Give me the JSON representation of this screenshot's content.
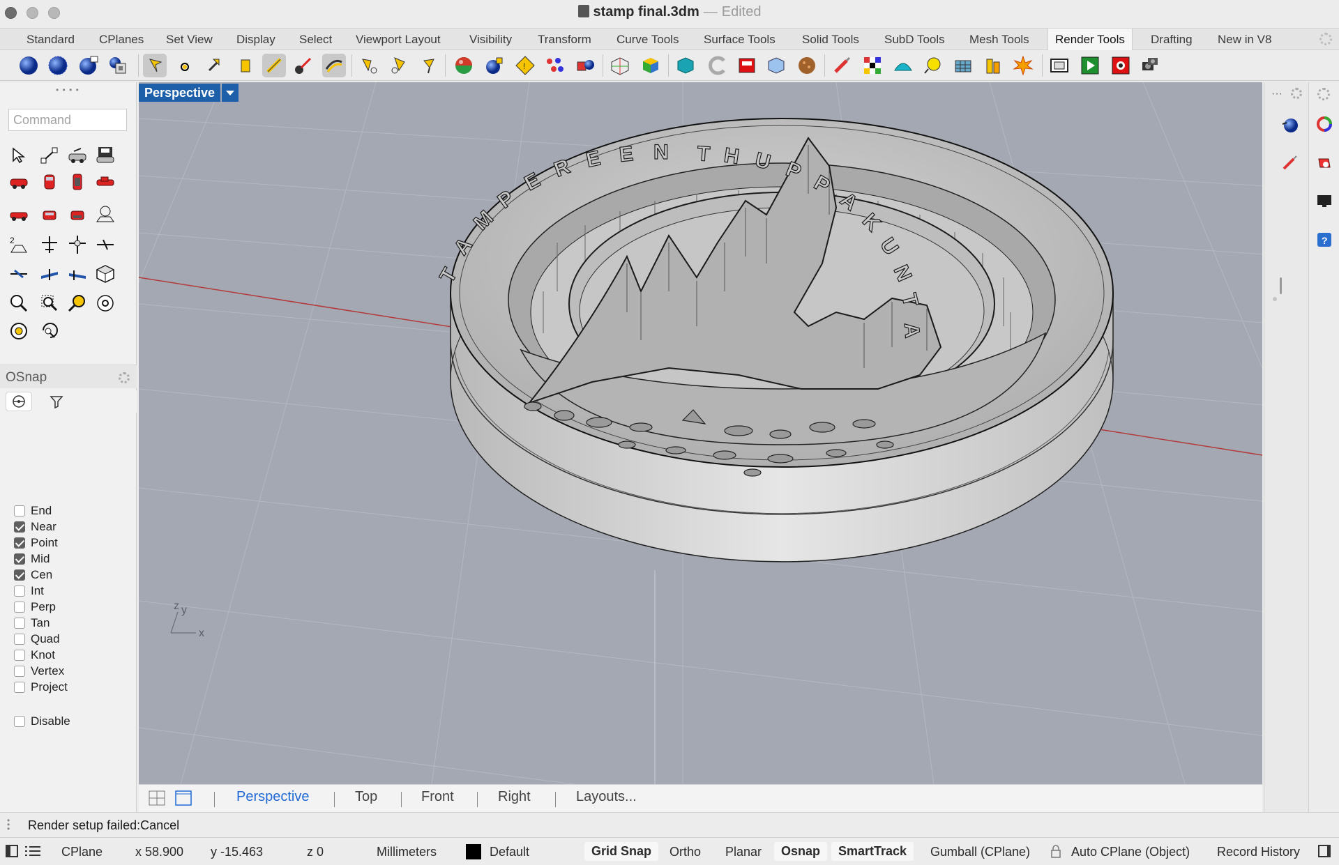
{
  "window": {
    "title": "stamp final.3dm",
    "separator": "—",
    "status": "Edited"
  },
  "tabs": [
    {
      "label": "Standard",
      "active": false
    },
    {
      "label": "CPlanes",
      "active": false
    },
    {
      "label": "Set View",
      "active": false
    },
    {
      "label": "Display",
      "active": false
    },
    {
      "label": "Select",
      "active": false
    },
    {
      "label": "Viewport Layout",
      "active": false
    },
    {
      "label": "Visibility",
      "active": false
    },
    {
      "label": "Transform",
      "active": false
    },
    {
      "label": "Curve Tools",
      "active": false
    },
    {
      "label": "Surface Tools",
      "active": false
    },
    {
      "label": "Solid Tools",
      "active": false
    },
    {
      "label": "SubD Tools",
      "active": false
    },
    {
      "label": "Mesh Tools",
      "active": false
    },
    {
      "label": "Render Tools",
      "active": true
    },
    {
      "label": "Drafting",
      "active": false
    },
    {
      "label": "New in V8",
      "active": false
    }
  ],
  "command": {
    "placeholder": "Command"
  },
  "viewport": {
    "name": "Perspective",
    "axis_x": "x",
    "axis_y": "y",
    "axis_z": "z"
  },
  "model": {
    "ring_letters": [
      "T",
      "A",
      "M",
      "P",
      "E",
      "R",
      "E",
      "E",
      "N",
      "T",
      "H",
      "U",
      "P",
      "P",
      "A",
      "K",
      "U",
      "N",
      "T",
      "A"
    ]
  },
  "osnap": {
    "title": "OSnap",
    "items": [
      {
        "label": "End",
        "checked": false
      },
      {
        "label": "Near",
        "checked": true
      },
      {
        "label": "Point",
        "checked": true
      },
      {
        "label": "Mid",
        "checked": true
      },
      {
        "label": "Cen",
        "checked": true
      },
      {
        "label": "Int",
        "checked": false
      },
      {
        "label": "Perp",
        "checked": false
      },
      {
        "label": "Tan",
        "checked": false
      },
      {
        "label": "Quad",
        "checked": false
      },
      {
        "label": "Knot",
        "checked": false
      },
      {
        "label": "Vertex",
        "checked": false
      },
      {
        "label": "Project",
        "checked": false
      }
    ],
    "disable_label": "Disable",
    "disable_checked": false
  },
  "viewport_tabs": {
    "perspective": "Perspective",
    "top": "Top",
    "front": "Front",
    "right": "Right",
    "layouts": "Layouts..."
  },
  "history": {
    "message": "Render setup failed:Cancel"
  },
  "statusbar": {
    "cplane": "CPlane",
    "x": "x 58.900",
    "y": "y -15.463",
    "z": "z 0",
    "units": "Millimeters",
    "layer": "Default",
    "layer_color": "#000000",
    "grid_snap": "Grid Snap",
    "ortho": "Ortho",
    "planar": "Planar",
    "osnap": "Osnap",
    "smarttrack": "SmartTrack",
    "gumball": "Gumball (CPlane)",
    "auto_cplane": "Auto CPlane (Object)",
    "record_history": "Record History"
  },
  "colors": {
    "viewport_bg": "#a4a8b2",
    "viewport_label": "#1d5fa8",
    "active_tab_text": "#1f6ad6",
    "x_axis": "#b33a3a"
  }
}
